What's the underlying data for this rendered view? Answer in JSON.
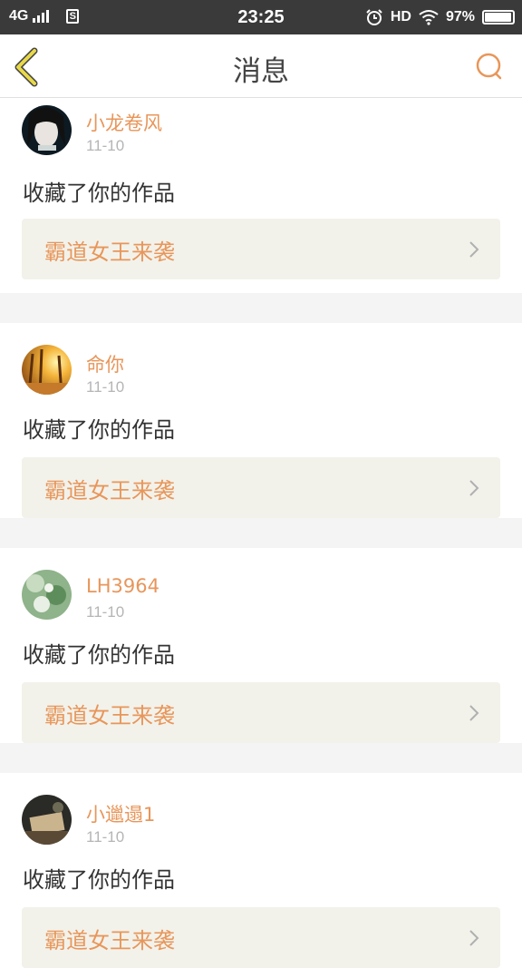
{
  "status_bar": {
    "network": "4G",
    "time": "23:25",
    "hd": "HD",
    "battery": "97%",
    "battery_level": 0.97
  },
  "header": {
    "title": "消息"
  },
  "messages": [
    {
      "username": "小龙卷风",
      "date": "11-10",
      "action": "收藏了你的作品",
      "work_title": "霸道女王来袭"
    },
    {
      "username": "命你",
      "date": "11-10",
      "action": "收藏了你的作品",
      "work_title": "霸道女王来袭"
    },
    {
      "username": "LH3964",
      "date": "11-10",
      "action": "收藏了你的作品",
      "work_title": "霸道女王来袭"
    },
    {
      "username": "小邋遢1",
      "date": "11-10",
      "action": "收藏了你的作品",
      "work_title": "霸道女王来袭"
    }
  ],
  "colors": {
    "accent": "#e8965a",
    "status_bar_bg": "#3a3a3a",
    "card_bg": "#ffffff",
    "work_link_bg": "#f2f2eb",
    "back_icon": "#e8d84a"
  },
  "icons": [
    "back-arrow-icon",
    "search-icon",
    "chevron-right-icon",
    "alarm-icon",
    "wifi-icon",
    "battery-icon",
    "signal-icon",
    "sim-icon"
  ]
}
